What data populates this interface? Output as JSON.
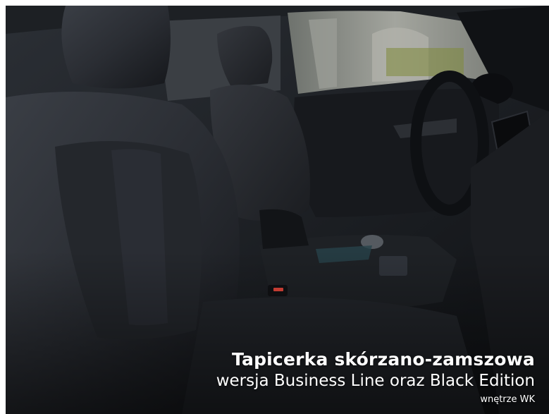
{
  "caption": {
    "title": "Tapicerka skórzano-zamszowa",
    "subtitle": "wersja Business Line oraz Black Edition",
    "note": "wnętrze WK"
  },
  "colors": {
    "seat": "#2a2d33",
    "cabin": "#14161a",
    "window": "#8c8f88",
    "accent_red": "#e0453a"
  }
}
